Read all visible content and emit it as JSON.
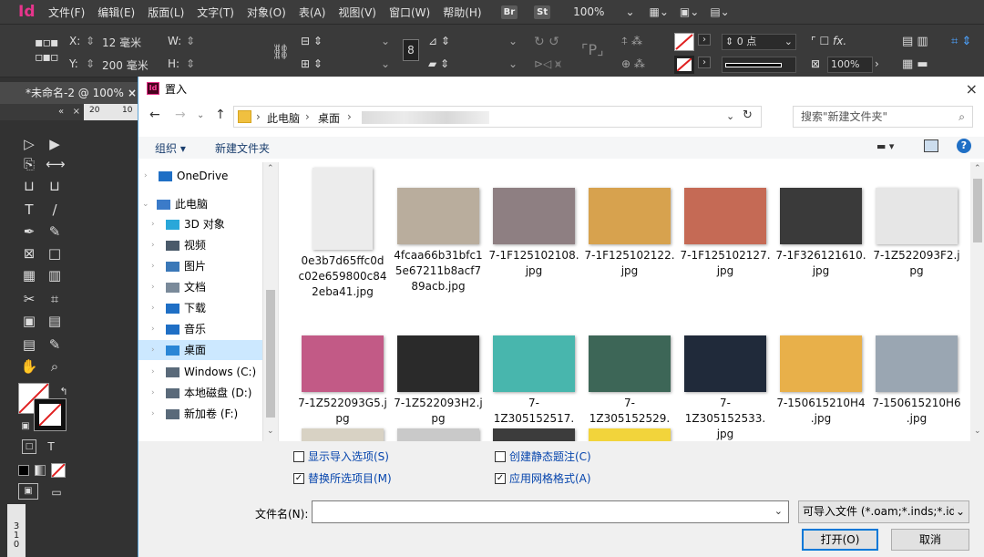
{
  "app": {
    "logo": "Id",
    "menus": [
      "文件(F)",
      "编辑(E)",
      "版面(L)",
      "文字(T)",
      "对象(O)",
      "表(A)",
      "视图(V)",
      "窗口(W)",
      "帮助(H)"
    ],
    "badges": [
      "Br",
      "St"
    ],
    "zoom": "100%"
  },
  "control_panel": {
    "x_label": "X:",
    "x_value": "12 毫米",
    "y_label": "Y:",
    "y_value": "200 毫米",
    "w_label": "W:",
    "h_label": "H:",
    "stroke_weight": "0 点",
    "scale_value": "100%"
  },
  "document_tab": {
    "title": "*未命名-2 @ 100%",
    "close": "×",
    "ruler_a": "20",
    "ruler_b": "10",
    "vruler": [
      "3",
      "1",
      "0"
    ],
    "panel_collapse": "«",
    "panel_close": "×",
    "format_text_label": "T"
  },
  "dialog": {
    "title": "置入",
    "close": "×",
    "address": {
      "crumbs": [
        "此电脑",
        "桌面"
      ],
      "separator": "›"
    },
    "search_placeholder": "搜索\"新建文件夹\"",
    "toolbar": {
      "organize": "组织 ▾",
      "new_folder": "新建文件夹"
    },
    "nav_items": [
      {
        "label": "OneDrive",
        "icon": "cloud-icon",
        "color": "#1f6fc5"
      },
      {
        "label": "此电脑",
        "icon": "computer-icon",
        "color": "#3b7bc9"
      },
      {
        "label": "3D 对象",
        "icon": "cube-icon",
        "color": "#2aa7d9"
      },
      {
        "label": "视频",
        "icon": "film-icon",
        "color": "#4a5a6a"
      },
      {
        "label": "图片",
        "icon": "picture-icon",
        "color": "#3a78b8"
      },
      {
        "label": "文档",
        "icon": "document-icon",
        "color": "#7a8a9a"
      },
      {
        "label": "下载",
        "icon": "download-icon",
        "color": "#1f6fc5"
      },
      {
        "label": "音乐",
        "icon": "music-icon",
        "color": "#1f6fc5"
      },
      {
        "label": "桌面",
        "icon": "desktop-icon",
        "color": "#2a86d6"
      },
      {
        "label": "Windows (C:)",
        "icon": "drive-icon",
        "color": "#5a6a7a"
      },
      {
        "label": "本地磁盘 (D:)",
        "icon": "drive-icon",
        "color": "#5a6a7a"
      },
      {
        "label": "新加卷 (F:)",
        "icon": "drive-icon",
        "color": "#5a6a7a"
      }
    ],
    "files": [
      {
        "name": [
          "0e3b7d65ffc0d",
          "c02e659800c84",
          "2eba41.jpg"
        ],
        "color": "#ececec"
      },
      {
        "name": [
          "4fcaa66b31bfc1",
          "5e67211b8acf7",
          "89acb.jpg"
        ],
        "color": "#b9ad9d"
      },
      {
        "name": [
          "7-1F125102108.",
          "jpg"
        ],
        "color": "#8e7f82"
      },
      {
        "name": [
          "7-1F125102122.",
          "jpg"
        ],
        "color": "#d7a24e"
      },
      {
        "name": [
          "7-1F125102127.",
          "jpg"
        ],
        "color": "#c56a55"
      },
      {
        "name": [
          "7-1F326121610.",
          "jpg"
        ],
        "color": "#3a3a3a"
      },
      {
        "name": [
          "7-1Z522093F2.j",
          "pg"
        ],
        "color": "#e6e6e6"
      },
      {
        "name": [
          "7-1Z522093G5.j",
          "pg"
        ],
        "color": "#c25a86"
      },
      {
        "name": [
          "7-1Z522093H2.j",
          "pg"
        ],
        "color": "#2a2a2a"
      },
      {
        "name": [
          "7-1Z305152517.",
          "jpg"
        ],
        "color": "#48b6ad"
      },
      {
        "name": [
          "7-1Z305152529.",
          "jpg"
        ],
        "color": "#3d6657"
      },
      {
        "name": [
          "7-1Z305152533.",
          "jpg"
        ],
        "color": "#202a3a"
      },
      {
        "name": [
          "7-150615210H4",
          ".jpg"
        ],
        "color": "#e8b04a"
      },
      {
        "name": [
          "7-150615210H6",
          ".jpg"
        ],
        "color": "#9aa6b2"
      },
      {
        "name": [],
        "color": "#d8d2c4"
      },
      {
        "name": [],
        "color": "#c9c9c9"
      },
      {
        "name": [],
        "color": "#3c3c3c"
      },
      {
        "name": [],
        "color": "#f2d43b"
      }
    ],
    "options": {
      "show_import": "显示导入选项(S)",
      "replace": "替换所选项目(M)",
      "static_caption": "创建静态题注(C)",
      "apply_grid": "应用网格格式(A)"
    },
    "filename_label": "文件名(N):",
    "filetype_value": "可导入文件 (*.oam;*.inds;*.idr",
    "open_button": "打开(O)",
    "cancel_button": "取消"
  }
}
